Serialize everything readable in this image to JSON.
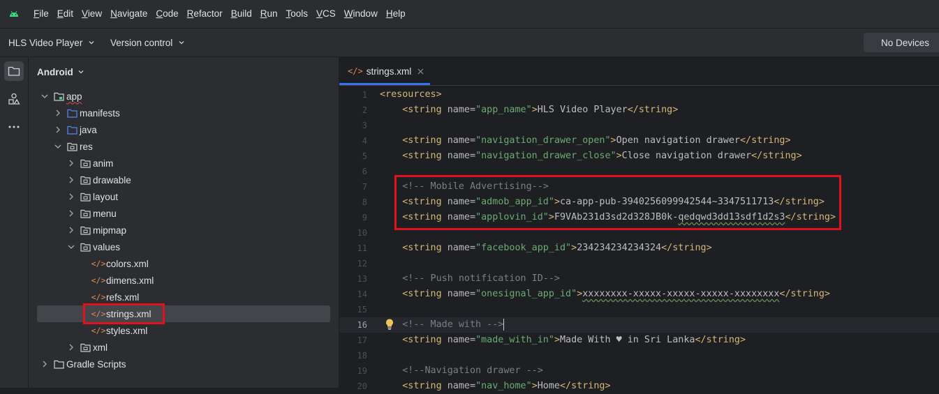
{
  "menu": {
    "items": [
      "File",
      "Edit",
      "View",
      "Navigate",
      "Code",
      "Refactor",
      "Build",
      "Run",
      "Tools",
      "VCS",
      "Window",
      "Help"
    ]
  },
  "toolbar": {
    "project_name": "HLS Video Player",
    "vcs_label": "Version control",
    "devices_label": "No Devices"
  },
  "project_panel": {
    "view_label": "Android",
    "tree": [
      {
        "label": "app",
        "icon": "module-icon",
        "expanded": true,
        "depth": 0
      },
      {
        "label": "manifests",
        "icon": "folder-icon",
        "expanded": false,
        "depth": 1
      },
      {
        "label": "java",
        "icon": "folder-icon",
        "expanded": false,
        "depth": 1
      },
      {
        "label": "res",
        "icon": "res-folder-icon",
        "expanded": true,
        "depth": 1
      },
      {
        "label": "anim",
        "icon": "res-folder-icon",
        "expanded": false,
        "depth": 2
      },
      {
        "label": "drawable",
        "icon": "res-folder-icon",
        "expanded": false,
        "depth": 2
      },
      {
        "label": "layout",
        "icon": "res-folder-icon",
        "expanded": false,
        "depth": 2
      },
      {
        "label": "menu",
        "icon": "res-folder-icon",
        "expanded": false,
        "depth": 2
      },
      {
        "label": "mipmap",
        "icon": "res-folder-icon",
        "expanded": false,
        "depth": 2
      },
      {
        "label": "values",
        "icon": "res-folder-icon",
        "expanded": true,
        "depth": 2
      },
      {
        "label": "colors.xml",
        "icon": "xml-file-icon",
        "depth": 3
      },
      {
        "label": "dimens.xml",
        "icon": "xml-file-icon",
        "depth": 3
      },
      {
        "label": "refs.xml",
        "icon": "xml-file-icon",
        "depth": 3
      },
      {
        "label": "strings.xml",
        "icon": "xml-file-icon",
        "depth": 3,
        "selected": true
      },
      {
        "label": "styles.xml",
        "icon": "xml-file-icon",
        "depth": 3
      },
      {
        "label": "xml",
        "icon": "res-folder-icon",
        "expanded": false,
        "depth": 2
      },
      {
        "label": "Gradle Scripts",
        "icon": "gradle-icon",
        "expanded": false,
        "depth": 0
      }
    ]
  },
  "editor": {
    "tab_label": "strings.xml",
    "current_line": 16,
    "lines": [
      {
        "n": "1",
        "parts": [
          [
            "tag",
            "<resources>"
          ]
        ]
      },
      {
        "n": "2",
        "parts": [
          [
            "tag",
            "    <string "
          ],
          [
            "attr",
            "name="
          ],
          [
            "val",
            "\"app_name\""
          ],
          [
            "tag",
            ">"
          ],
          [
            "txt",
            "HLS Video Player"
          ],
          [
            "tag",
            "</string>"
          ]
        ]
      },
      {
        "n": "3",
        "parts": []
      },
      {
        "n": "4",
        "parts": [
          [
            "tag",
            "    <string "
          ],
          [
            "attr",
            "name="
          ],
          [
            "val",
            "\"navigation_drawer_open\""
          ],
          [
            "tag",
            ">"
          ],
          [
            "txt",
            "Open navigation drawer"
          ],
          [
            "tag",
            "</string>"
          ]
        ]
      },
      {
        "n": "5",
        "parts": [
          [
            "tag",
            "    <string "
          ],
          [
            "attr",
            "name="
          ],
          [
            "val",
            "\"navigation_drawer_close\""
          ],
          [
            "tag",
            ">"
          ],
          [
            "txt",
            "Close navigation drawer"
          ],
          [
            "tag",
            "</string>"
          ]
        ]
      },
      {
        "n": "6",
        "parts": []
      },
      {
        "n": "7",
        "parts": [
          [
            "cmt",
            "    <!-- Mobile Advertising-->"
          ]
        ]
      },
      {
        "n": "8",
        "parts": [
          [
            "tag",
            "    <string "
          ],
          [
            "attr",
            "name="
          ],
          [
            "val",
            "\"admob_app_id\""
          ],
          [
            "tag",
            ">"
          ],
          [
            "txt",
            "ca-app-pub-3940256099942544~3347511713"
          ],
          [
            "tag",
            "</string>"
          ]
        ]
      },
      {
        "n": "9",
        "parts": [
          [
            "tag",
            "    <string "
          ],
          [
            "attr",
            "name="
          ],
          [
            "val",
            "\"applovin_id\""
          ],
          [
            "tag",
            ">"
          ],
          [
            "txt",
            "F9VAb231d3sd2d328JB0k-"
          ],
          [
            "txt squig",
            "qedqwd3dd13sdf1d2s3"
          ],
          [
            "tag",
            "</string>"
          ]
        ]
      },
      {
        "n": "10",
        "parts": []
      },
      {
        "n": "11",
        "parts": [
          [
            "tag",
            "    <string "
          ],
          [
            "attr",
            "name="
          ],
          [
            "val",
            "\"facebook_app_id\""
          ],
          [
            "tag",
            ">"
          ],
          [
            "txt",
            "234234234234324"
          ],
          [
            "tag",
            "</string>"
          ]
        ]
      },
      {
        "n": "12",
        "parts": []
      },
      {
        "n": "13",
        "parts": [
          [
            "cmt",
            "    <!-- Push notification ID-->"
          ]
        ]
      },
      {
        "n": "14",
        "parts": [
          [
            "tag",
            "    <string "
          ],
          [
            "attr",
            "name="
          ],
          [
            "val",
            "\"onesignal_app_id\""
          ],
          [
            "tag",
            ">"
          ],
          [
            "txt squig",
            "xxxxxxxx-xxxxx-xxxxx-xxxxx-xxxxxxxx"
          ],
          [
            "tag",
            "</string>"
          ]
        ]
      },
      {
        "n": "15",
        "parts": []
      },
      {
        "n": "16",
        "parts": [
          [
            "cmt",
            "    <!-- Made with -->"
          ]
        ]
      },
      {
        "n": "17",
        "parts": [
          [
            "tag",
            "    <string "
          ],
          [
            "attr",
            "name="
          ],
          [
            "val",
            "\"made_with_in\""
          ],
          [
            "tag",
            ">"
          ],
          [
            "txt",
            "Made With ♥ in Sri Lanka"
          ],
          [
            "tag",
            "</string>"
          ]
        ]
      },
      {
        "n": "18",
        "parts": []
      },
      {
        "n": "19",
        "parts": [
          [
            "cmt",
            "    <!--Navigation drawer -->"
          ]
        ]
      },
      {
        "n": "20",
        "parts": [
          [
            "tag",
            "    <string "
          ],
          [
            "attr",
            "name="
          ],
          [
            "val",
            "\"nav_home\""
          ],
          [
            "tag",
            ">"
          ],
          [
            "txt",
            "Home"
          ],
          [
            "tag",
            "</string>"
          ]
        ]
      }
    ]
  },
  "colors": {
    "accent": "#3574f0",
    "highlight_box": "#e0121d"
  }
}
